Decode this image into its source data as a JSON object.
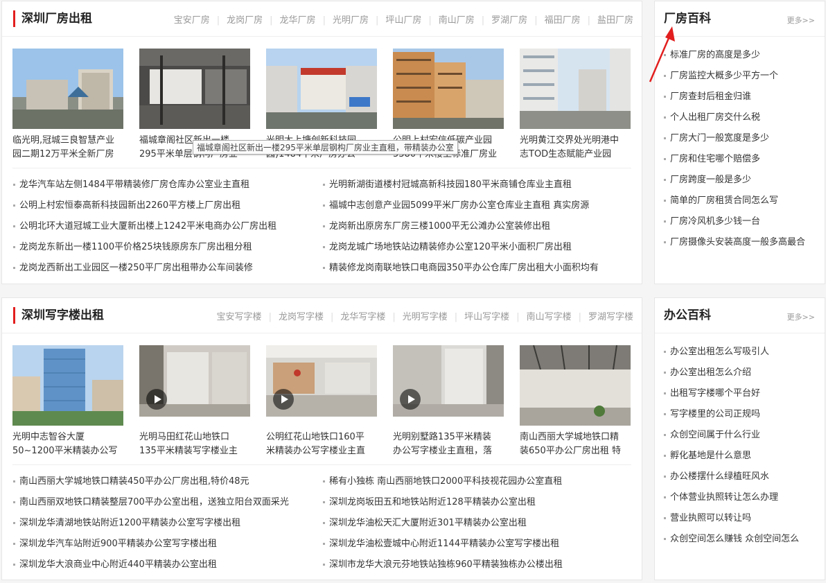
{
  "factory": {
    "title": "深圳厂房出租",
    "links": [
      "宝安厂房",
      "龙岗厂房",
      "龙华厂房",
      "光明厂房",
      "坪山厂房",
      "南山厂房",
      "罗湖厂房",
      "福田厂房",
      "盐田厂房"
    ],
    "cards": [
      {
        "l1": "临光明,冠城三良智慧产业",
        "l2": "园二期12万平米全新厂房"
      },
      {
        "l1": "福城章阁社区新出一楼",
        "l2": "295平米单层钢构厂房业"
      },
      {
        "l1": "光明大上塘创新科技园",
        "l2": "园)1484平米厂房办公"
      },
      {
        "l1": "公明上村宏信低碳产业园",
        "l2": "5380平米楼上标准厂房业"
      },
      {
        "l1": "光明黄江交界处光明港中",
        "l2": "志TOD生态赋能产业园"
      }
    ],
    "tooltip": "福城章阁社区新出一楼295平米单层钢构厂房业主直租，带精装办公室",
    "list_left": [
      "龙华汽车站左侧1484平带精装修厂房仓库办公室业主直租",
      "公明上村宏恒泰高新科技园新出2260平方楼上厂房出租",
      "公明北环大道冠城工业大厦新出楼上1242平米电商办公厂房出租",
      "龙岗龙东新出一楼1100平价格25块钱原房东厂房出租分租",
      "龙岗龙西新出工业园区一楼250平厂房出租带办公车间装修"
    ],
    "list_right": [
      "光明新湖街道楼村冠城高新科技园180平米商铺仓库业主直租",
      "福城中志创意产业园5099平米厂房办公室仓库业主直租 真实房源",
      "龙岗新出原房东厂房三楼1000平无公滩办公室装修出租",
      "龙岗龙城广场地铁站边精装修办公室120平米小面积厂房出租",
      "精装修龙岗南联地铁口电商园350平办公仓库厂房出租大小面积均有"
    ]
  },
  "office": {
    "title": "深圳写字楼出租",
    "links": [
      "宝安写字楼",
      "龙岗写字楼",
      "龙华写字楼",
      "光明写字楼",
      "坪山写字楼",
      "南山写字楼",
      "罗湖写字楼"
    ],
    "cards": [
      {
        "l1": "光明中志智谷大厦",
        "l2": "50~1200平米精装办公写"
      },
      {
        "l1": "光明马田红花山地铁口",
        "l2": "135平米精装写字楼业主"
      },
      {
        "l1": "公明红花山地铁口160平",
        "l2": "米精装办公写字楼业主直"
      },
      {
        "l1": "光明别墅路135平米精装",
        "l2": "办公写字楼业主直租，落"
      },
      {
        "l1": "南山西丽大学城地铁口精",
        "l2": "装650平办公厂房出租 特"
      }
    ],
    "list_left": [
      "南山西丽大学城地铁口精装450平办公厂房出租,特价48元",
      "南山西丽双地铁口精装整层700平办公室出租，送独立阳台双面采光",
      "深圳龙华清湖地铁站附近1200平精装办公室写字楼出租",
      "深圳龙华汽车站附近900平精装办公室写字楼出租",
      "深圳龙华大浪商业中心附近440平精装办公室出租"
    ],
    "list_right": [
      "稀有小独栋 南山西丽地铁口2000平科技视花园办公室直租",
      "深圳龙岗坂田五和地铁站附近128平精装办公室出租",
      "深圳龙华油松天汇大厦附近301平精装办公室出租",
      "深圳龙华油松壹城中心附近1144平精装办公室写字楼出租",
      "深圳市龙华大浪元芬地铁站独栋960平精装独栋办公楼出租"
    ]
  },
  "factory_wiki": {
    "title": "厂房百科",
    "more": "更多>>",
    "items": [
      "标准厂房的高度是多少",
      "厂房监控大概多少平方一个",
      "厂房查封后租金归谁",
      "个人出租厂房交什么税",
      "厂房大门一般宽度是多少",
      "厂房和住宅哪个赔偿多",
      "厂房跨度一般是多少",
      "简单的厂房租赁合同怎么写",
      "厂房冷风机多少钱一台",
      "厂房摄像头安装高度一般多高最合"
    ]
  },
  "office_wiki": {
    "title": "办公百科",
    "more": "更多>>",
    "items": [
      "办公室出租怎么写吸引人",
      "办公室出租怎么介绍",
      "出租写字楼哪个平台好",
      "写字楼里的公司正规吗",
      "众创空间属于什么行业",
      "孵化基地是什么意思",
      "办公楼摆什么绿植旺风水",
      "个体营业执照转让怎么办理",
      "营业执照可以转让吗",
      "众创空间怎么赚钱 众创空间怎么"
    ]
  },
  "colors": {
    "accent": "#e21e1e",
    "arrow": "#e21e1e"
  }
}
